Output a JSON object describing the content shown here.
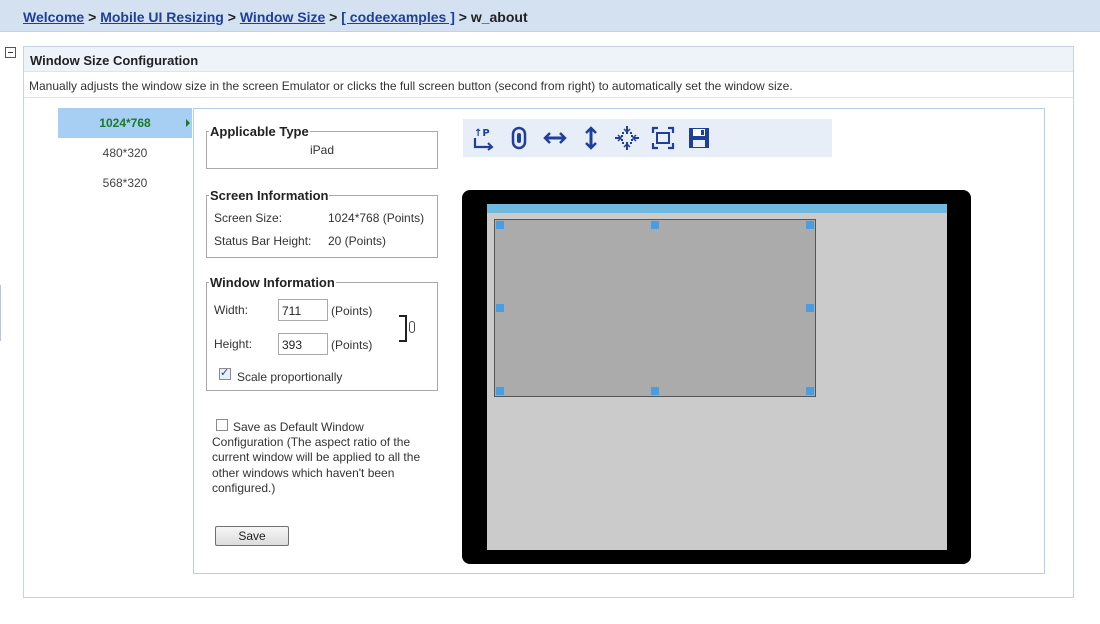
{
  "breadcrumb": {
    "items": [
      "Welcome",
      "Mobile UI Resizing",
      "Window Size",
      "[ codeexamples ]"
    ],
    "current": "w_about",
    "separator": ">"
  },
  "panel": {
    "title": "Window Size Configuration",
    "description": "Manually adjusts the window size in the screen Emulator or clicks the full screen button (second from right) to automatically set the window size."
  },
  "sizes": [
    "1024*768",
    "480*320",
    "568*320"
  ],
  "selected_size": "1024*768",
  "applicable_type": {
    "legend": "Applicable Type",
    "value": "iPad"
  },
  "screen_info": {
    "legend": "Screen Information",
    "screen_size_label": "Screen Size:",
    "screen_size_value": "1024*768 (Points)",
    "status_bar_label": "Status Bar Height:",
    "status_bar_value": "20 (Points)"
  },
  "window_info": {
    "legend": "Window Information",
    "width_label": "Width:",
    "width_value": "711",
    "height_label": "Height:",
    "height_value": "393",
    "unit": "(Points)",
    "scale_label": "Scale proportionally",
    "scale_checked": true
  },
  "default_config": {
    "checked": false,
    "text": "Save as Default Window Configuration (The aspect ratio of the current window will be applied to all the other windows which haven't been configured.)"
  },
  "save_label": "Save",
  "toolbar_icons": [
    "portrait-landscape-icon",
    "link-icon",
    "fit-width-icon",
    "fit-height-icon",
    "center-icon",
    "full-screen-icon",
    "save-icon"
  ],
  "colors": {
    "header_bg": "#d3e1f0",
    "link": "#1f3f9a",
    "selected_bg": "#a7cef3",
    "selected_text": "#1b7a2c",
    "status_bar": "#6fb9e0",
    "handle": "#4a9de0",
    "window_fill": "#ababab",
    "screen_fill": "#cbcbcb"
  }
}
